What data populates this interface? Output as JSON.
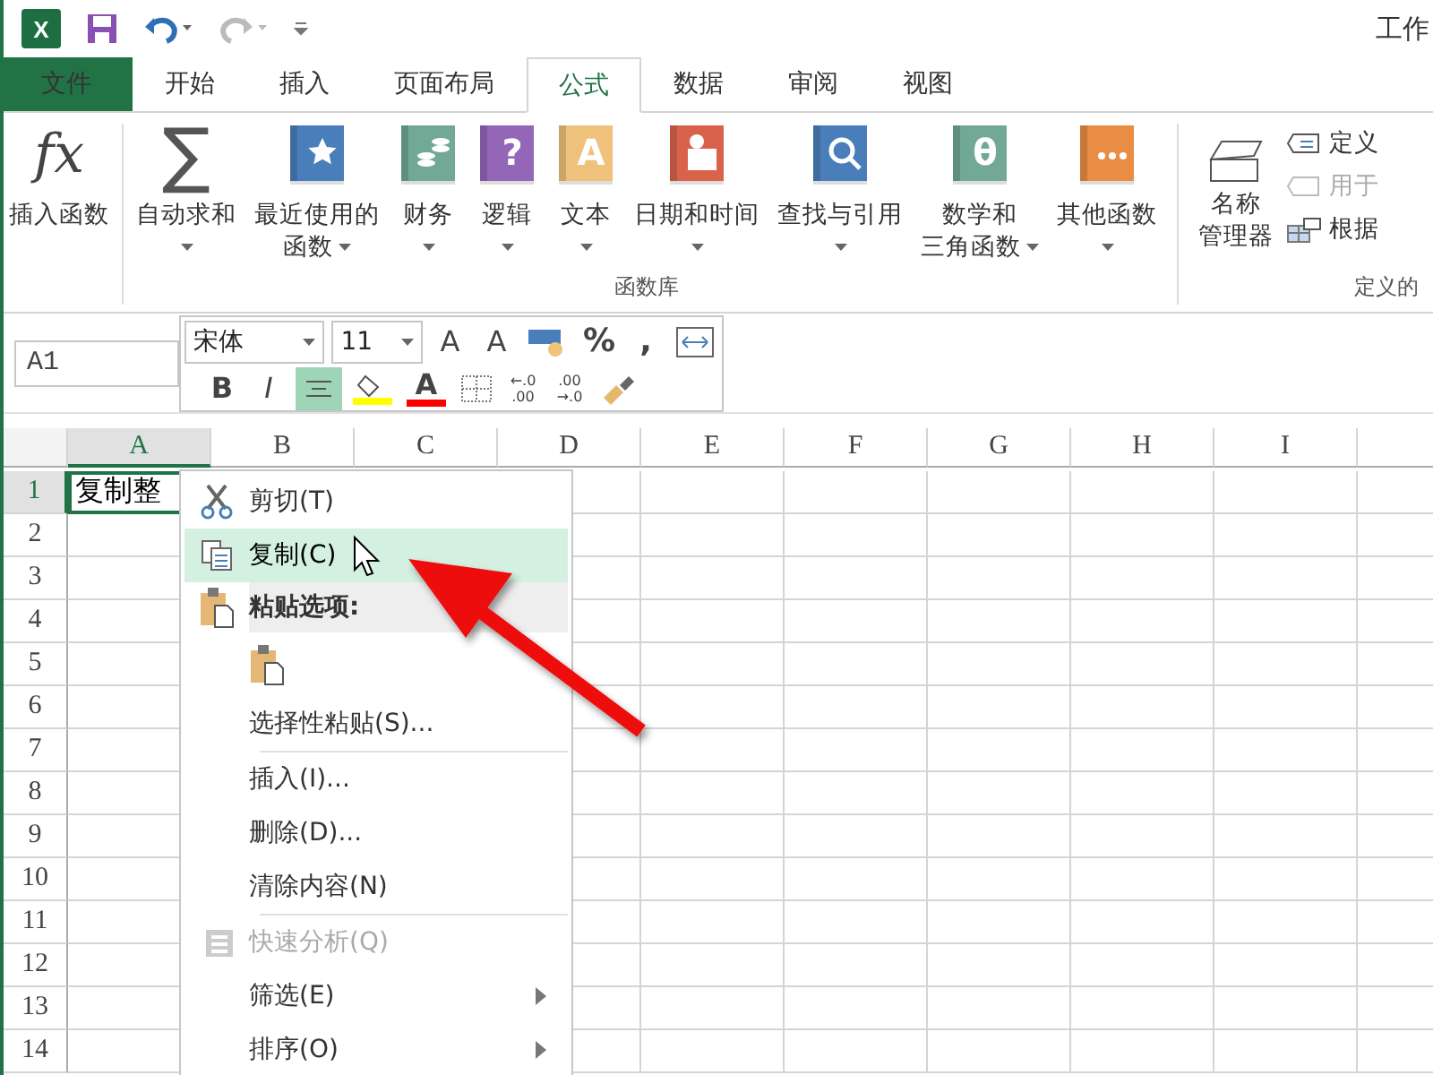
{
  "title_bar": {
    "logo_text": "X",
    "title": "工作"
  },
  "tabs": [
    {
      "label": "文件",
      "kind": "file",
      "selected": false
    },
    {
      "label": "开始",
      "kind": "tab",
      "selected": false
    },
    {
      "label": "插入",
      "kind": "tab",
      "selected": false
    },
    {
      "label": "页面布局",
      "kind": "tab",
      "selected": false
    },
    {
      "label": "公式",
      "kind": "tab",
      "selected": true
    },
    {
      "label": "数据",
      "kind": "tab",
      "selected": false
    },
    {
      "label": "审阅",
      "kind": "tab",
      "selected": false
    },
    {
      "label": "视图",
      "kind": "tab",
      "selected": false
    }
  ],
  "ribbon": {
    "groups": [
      {
        "buttons": [
          {
            "lines": [
              "插入函数"
            ],
            "dropdown": false,
            "kind": "insert",
            "glyph": "fx"
          }
        ]
      },
      {
        "label": "函数库",
        "buttons": [
          {
            "lines": [
              "自动求和"
            ],
            "dropdown": true,
            "kind": "sum",
            "glyph": "∑"
          },
          {
            "lines": [
              "最近使用的",
              "函数"
            ],
            "dropdown": true,
            "kind": "recent",
            "color": "#4a7ebb"
          },
          {
            "lines": [
              "财务"
            ],
            "dropdown": true,
            "kind": "finance",
            "color": "#72a896"
          },
          {
            "lines": [
              "逻辑"
            ],
            "dropdown": true,
            "kind": "logic",
            "glyph": "?",
            "color": "#9466b8"
          },
          {
            "lines": [
              "文本"
            ],
            "dropdown": true,
            "kind": "text",
            "glyph": "A",
            "color": "#eec27a"
          },
          {
            "lines": [
              "日期和时间"
            ],
            "dropdown": true,
            "kind": "date",
            "color": "#d9634a"
          },
          {
            "lines": [
              "查找与引用"
            ],
            "dropdown": true,
            "kind": "lookup",
            "color": "#4a7ebb"
          },
          {
            "lines": [
              "数学和",
              "三角函数"
            ],
            "dropdown": true,
            "kind": "math",
            "glyph": "θ",
            "color": "#72a896"
          },
          {
            "lines": [
              "其他函数"
            ],
            "dropdown": true,
            "kind": "other",
            "color": "#e88d43"
          }
        ]
      }
    ],
    "names": {
      "manager": [
        "名称",
        "管理器"
      ],
      "items": [
        {
          "label": "定义",
          "disabled": false
        },
        {
          "label": "用于",
          "disabled": true
        },
        {
          "label": "根据",
          "disabled": false
        }
      ],
      "group_label": "定义的"
    }
  },
  "name_box": "A1",
  "mini_toolbar": {
    "font": "宋体",
    "size": "11",
    "row1": [
      {
        "kind": "grow",
        "text": "A"
      },
      {
        "kind": "shrink",
        "text": "A"
      },
      {
        "kind": "currency"
      },
      {
        "kind": "text",
        "text": "%"
      },
      {
        "kind": "text",
        "text": ","
      },
      {
        "kind": "merge"
      }
    ],
    "row2": [
      {
        "kind": "bold",
        "text": "B",
        "selected": false
      },
      {
        "kind": "italic",
        "text": "I",
        "selected": false
      },
      {
        "kind": "align",
        "selected": true
      },
      {
        "kind": "fill",
        "color": "#ffff00",
        "selected": false
      },
      {
        "kind": "fontcolor",
        "text": "A",
        "color": "#ff0000",
        "selected": false
      },
      {
        "kind": "border",
        "selected": false
      },
      {
        "kind": "decimal",
        "lines": [
          "←.0",
          ".00"
        ],
        "selected": false
      },
      {
        "kind": "decimal",
        "lines": [
          ".00",
          "→.0"
        ],
        "selected": false
      },
      {
        "kind": "painter",
        "selected": false
      }
    ]
  },
  "columns": [
    {
      "label": "A",
      "selected": true
    },
    {
      "label": "B",
      "selected": false
    },
    {
      "label": "C",
      "selected": false
    },
    {
      "label": "D",
      "selected": false
    },
    {
      "label": "E",
      "selected": false
    },
    {
      "label": "F",
      "selected": false
    },
    {
      "label": "G",
      "selected": false
    },
    {
      "label": "H",
      "selected": false
    },
    {
      "label": "I",
      "selected": false
    }
  ],
  "rows": [
    {
      "header": "1",
      "selected": true,
      "cells": [
        {
          "text": "复制整",
          "selected": true
        }
      ]
    },
    {
      "header": "2",
      "selected": false
    },
    {
      "header": "3",
      "selected": false
    },
    {
      "header": "4",
      "selected": false
    },
    {
      "header": "5",
      "selected": false
    },
    {
      "header": "6",
      "selected": false
    },
    {
      "header": "7",
      "selected": false
    },
    {
      "header": "8",
      "selected": false
    },
    {
      "header": "9",
      "selected": false
    },
    {
      "header": "10",
      "selected": false
    },
    {
      "header": "11",
      "selected": false
    },
    {
      "header": "12",
      "selected": false
    },
    {
      "header": "13",
      "selected": false
    },
    {
      "header": "14",
      "selected": false
    }
  ],
  "context_menu": [
    {
      "kind": "item",
      "label": "剪切(T)",
      "selected": false,
      "disabled": false,
      "submenu": false
    },
    {
      "kind": "item",
      "label": "复制(C)",
      "selected": true,
      "disabled": false,
      "submenu": false
    },
    {
      "kind": "header",
      "label": "粘贴选项:"
    },
    {
      "kind": "paste"
    },
    {
      "kind": "item",
      "label": "选择性粘贴(S)...",
      "selected": false,
      "disabled": false,
      "submenu": false
    },
    {
      "kind": "separator"
    },
    {
      "kind": "item",
      "label": "插入(I)...",
      "selected": false,
      "disabled": false,
      "submenu": false
    },
    {
      "kind": "item",
      "label": "删除(D)...",
      "selected": false,
      "disabled": false,
      "submenu": false
    },
    {
      "kind": "item",
      "label": "清除内容(N)",
      "selected": false,
      "disabled": false,
      "submenu": false
    },
    {
      "kind": "separator"
    },
    {
      "kind": "item",
      "label": "快速分析(Q)",
      "selected": false,
      "disabled": true,
      "submenu": false
    },
    {
      "kind": "item",
      "label": "筛选(E)",
      "selected": false,
      "disabled": false,
      "submenu": true
    },
    {
      "kind": "item",
      "label": "排序(O)",
      "selected": false,
      "disabled": false,
      "submenu": true
    }
  ]
}
